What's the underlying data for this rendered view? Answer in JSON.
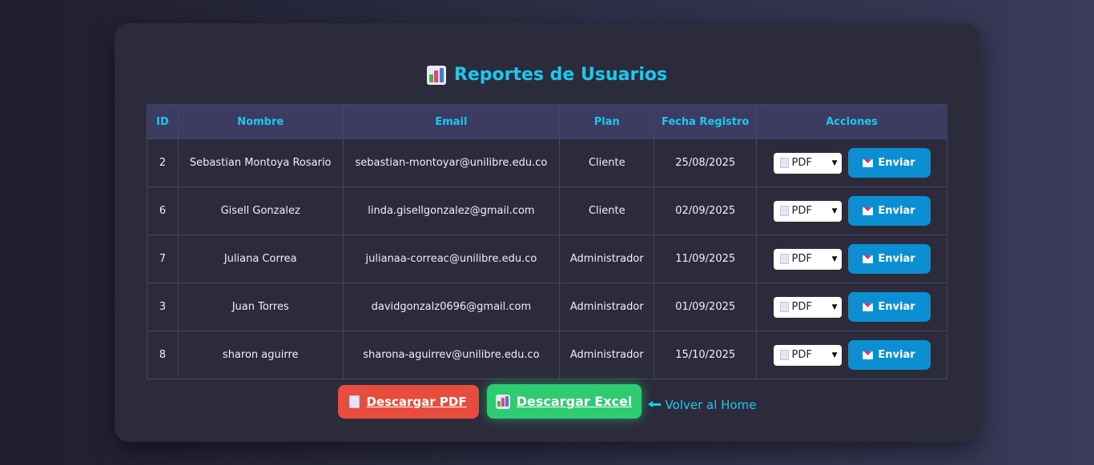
{
  "title": "Reportes de Usuarios",
  "table": {
    "headers": [
      "ID",
      "Nombre",
      "Email",
      "Plan",
      "Fecha Registro",
      "Acciones"
    ],
    "rows": [
      {
        "id": "2",
        "nombre": "Sebastian Montoya Rosario",
        "email": "sebastian-montoyar@unilibre.edu.co",
        "plan": "Cliente",
        "fecha": "25/08/2025",
        "formato": "PDF",
        "enviar": "Enviar"
      },
      {
        "id": "6",
        "nombre": "Gisell Gonzalez",
        "email": "linda.gisellgonzalez@gmail.com",
        "plan": "Cliente",
        "fecha": "02/09/2025",
        "formato": "PDF",
        "enviar": "Enviar"
      },
      {
        "id": "7",
        "nombre": "Juliana Correa",
        "email": "julianaa-correac@unilibre.edu.co",
        "plan": "Administrador",
        "fecha": "11/09/2025",
        "formato": "PDF",
        "enviar": "Enviar"
      },
      {
        "id": "3",
        "nombre": "Juan Torres",
        "email": "davidgonzalz0696@gmail.com",
        "plan": "Administrador",
        "fecha": "01/09/2025",
        "formato": "PDF",
        "enviar": "Enviar"
      },
      {
        "id": "8",
        "nombre": "sharon aguirre",
        "email": "sharona-aguirrev@unilibre.edu.co",
        "plan": "Administrador",
        "fecha": "15/10/2025",
        "formato": "PDF",
        "enviar": "Enviar"
      }
    ]
  },
  "buttons": {
    "pdf": "Descargar PDF",
    "excel": "Descargar Excel",
    "home": "Volver al Home"
  },
  "colors": {
    "accent": "#19c9f0",
    "send": "#0b8fd2",
    "pdf": "#e74c3c",
    "excel": "#2ecc71"
  },
  "icons": {
    "title": "bar-chart-icon",
    "select": "document-icon",
    "send": "envelope-icon",
    "pdf": "document-icon",
    "excel": "bar-chart-icon",
    "home": "arrow-left-icon"
  }
}
